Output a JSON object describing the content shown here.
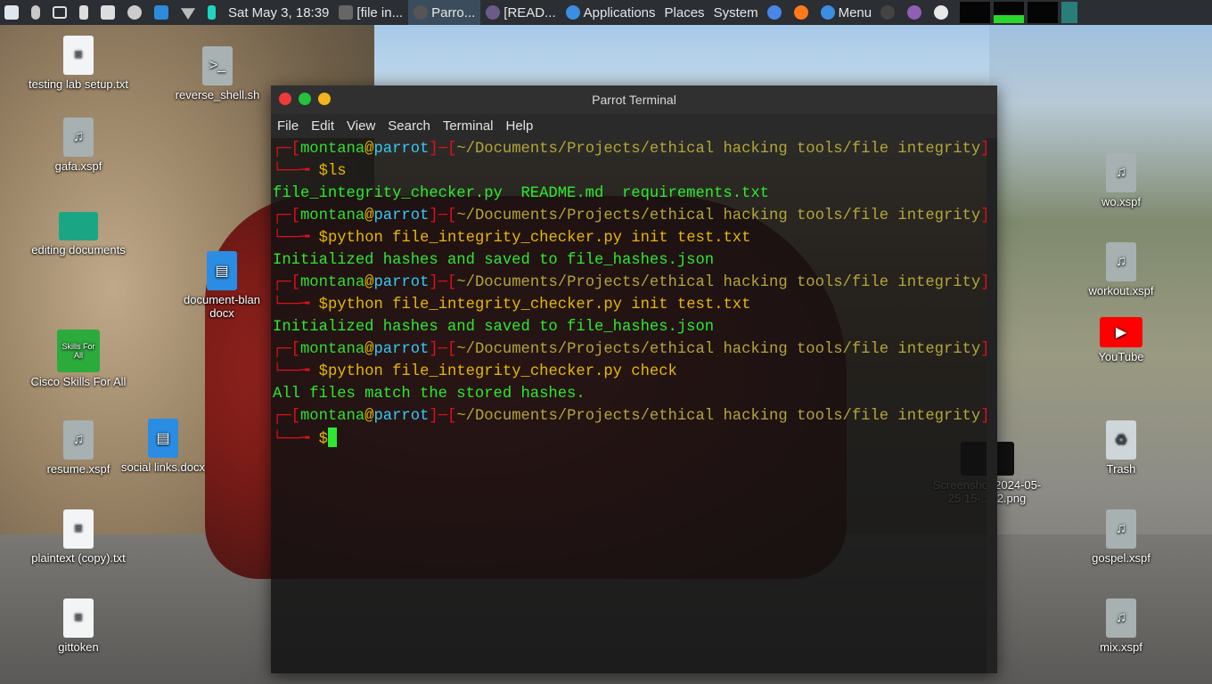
{
  "panel": {
    "datetime": "Sat May 3, 18:39",
    "tasks": [
      "[file in...",
      "Parro...",
      "[READ..."
    ],
    "applications_label": "Applications",
    "places_label": "Places",
    "system_label": "System",
    "menu_label": "Menu"
  },
  "desktop": {
    "left_icons": [
      {
        "label": "testing lab setup.txt",
        "icon": "text-file-icon"
      },
      {
        "label": "reverse_shell.sh",
        "icon": "script-file-icon"
      },
      {
        "label": "gafa.xspf",
        "icon": "music-file-icon"
      },
      {
        "label": "editing documents",
        "icon": "folder-icon"
      },
      {
        "label": "document-blan docx",
        "icon": "word-doc-icon"
      },
      {
        "label": "Cisco Skills For All",
        "icon": "cisco-icon"
      },
      {
        "label": "resume.xspf",
        "icon": "music-file-icon"
      },
      {
        "label": "social links.docx",
        "icon": "word-doc-icon"
      },
      {
        "label": "plaintext (copy).txt",
        "icon": "text-file-icon"
      },
      {
        "label": "gittoken",
        "icon": "text-file-icon"
      }
    ],
    "right_icons": [
      {
        "label": "wo.xspf",
        "icon": "music-file-icon"
      },
      {
        "label": "workout.xspf",
        "icon": "music-file-icon"
      },
      {
        "label": "YouTube",
        "icon": "youtube-icon"
      },
      {
        "label": "Trash",
        "icon": "trash-icon"
      },
      {
        "label": "Screenshot 2024-05-25 15-...22.png",
        "icon": "image-file-icon"
      },
      {
        "label": "gospel.xspf",
        "icon": "music-file-icon"
      },
      {
        "label": "mix.xspf",
        "icon": "music-file-icon"
      }
    ]
  },
  "terminal": {
    "title": "Parrot Terminal",
    "menu": [
      "File",
      "Edit",
      "View",
      "Search",
      "Terminal",
      "Help"
    ],
    "prompt_user": "montana",
    "prompt_host": "parrot",
    "prompt_path": "~/Documents/Projects/ethical hacking tools/file integrity",
    "commands": [
      "ls",
      "python file_integrity_checker.py init test.txt",
      "python file_integrity_checker.py init test.txt",
      "python file_integrity_checker.py check",
      ""
    ],
    "outputs": [
      "file_integrity_checker.py  README.md  requirements.txt",
      "Initialized hashes and saved to file_hashes.json",
      "Initialized hashes and saved to file_hashes.json",
      "All files match the stored hashes."
    ]
  },
  "colors": {
    "terminal_bg": "#121212",
    "prompt_bracket": "#e0101a",
    "prompt_user": "#33dd33",
    "prompt_host": "#38c8f5",
    "output_green": "#2ee92e"
  }
}
